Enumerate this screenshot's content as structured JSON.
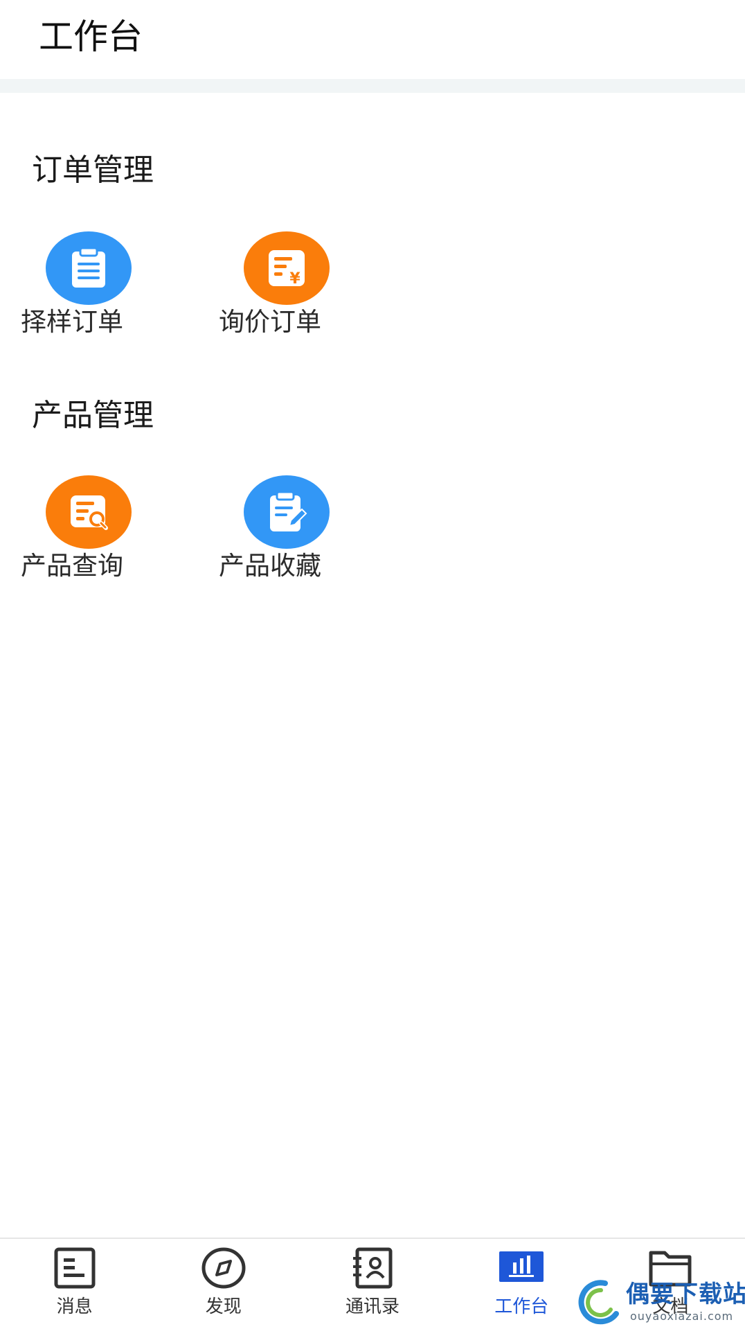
{
  "header": {
    "title": "工作台"
  },
  "sections": [
    {
      "title": "订单管理",
      "items": [
        {
          "label": "择样订单",
          "icon": "clipboard-list-icon",
          "color": "#3297f6"
        },
        {
          "label": "询价订单",
          "icon": "price-list-icon",
          "color": "#fa7d0b"
        }
      ]
    },
    {
      "title": "产品管理",
      "items": [
        {
          "label": "产品查询",
          "icon": "document-search-icon",
          "color": "#fa7d0b"
        },
        {
          "label": "产品收藏",
          "icon": "clipboard-edit-icon",
          "color": "#3297f6"
        }
      ]
    }
  ],
  "tabbar": {
    "active_color": "#1e57d8",
    "items": [
      {
        "label": "消息",
        "icon": "message-list-icon"
      },
      {
        "label": "发现",
        "icon": "compass-icon"
      },
      {
        "label": "通讯录",
        "icon": "contacts-book-icon"
      },
      {
        "label": "工作台",
        "icon": "workbench-chart-icon",
        "active": true
      },
      {
        "label": "文档",
        "icon": "folder-icon"
      }
    ]
  },
  "watermark": {
    "text": "偶要下载站",
    "url_text": "ouyaoxiazai.com"
  }
}
